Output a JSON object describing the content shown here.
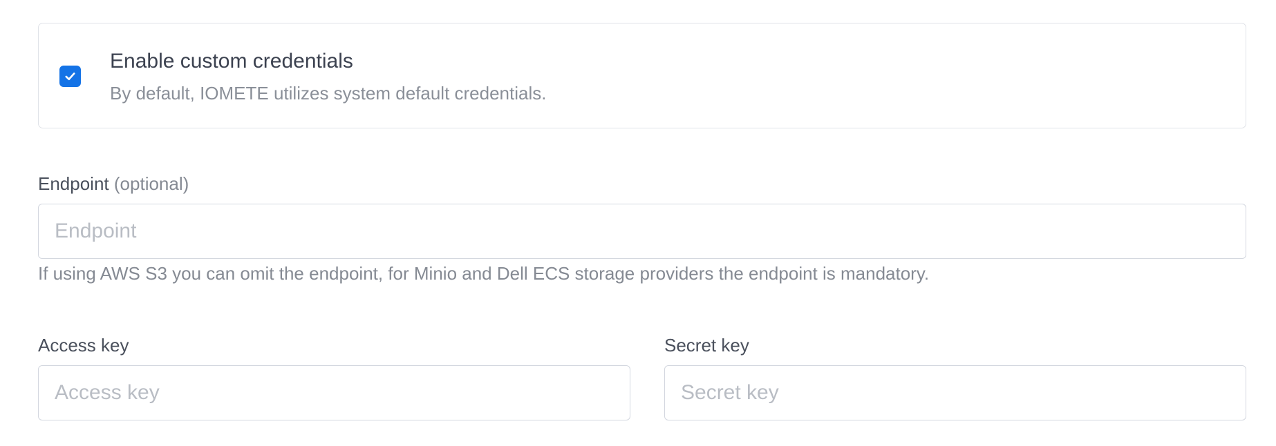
{
  "credentials_toggle": {
    "checked": true,
    "title": "Enable custom credentials",
    "description": "By default, IOMETE utilizes system default credentials."
  },
  "endpoint": {
    "label": "Endpoint",
    "optional_tag": "(optional)",
    "value": "",
    "placeholder": "Endpoint",
    "help": "If using AWS S3 you can omit the endpoint, for Minio and Dell ECS storage providers the endpoint is mandatory."
  },
  "access_key": {
    "label": "Access key",
    "value": "",
    "placeholder": "Access key"
  },
  "secret_key": {
    "label": "Secret key",
    "value": "",
    "placeholder": "Secret key"
  },
  "colors": {
    "accent": "#1473e6",
    "border": "#d3d7df",
    "text": "#3c4250",
    "muted": "#858a93",
    "placeholder": "#b9bdc4"
  },
  "icons": {
    "checkbox": "checkmark-icon"
  }
}
